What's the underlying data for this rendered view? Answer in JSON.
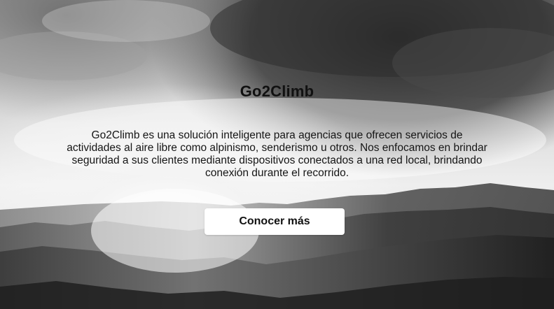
{
  "hero": {
    "title": "Go2Climb",
    "description": "Go2Climb es una solución inteligente para agencias que ofrecen servicios de actividades al aire libre como alpinismo, senderismo u otros. Nos enfocamos en brindar seguridad a sus clientes mediante dispositivos conectados a una red local, brindando conexión durante el recorrido.",
    "cta_label": "Conocer más"
  },
  "colors": {
    "button_bg": "#ffffff",
    "text": "#111111"
  }
}
